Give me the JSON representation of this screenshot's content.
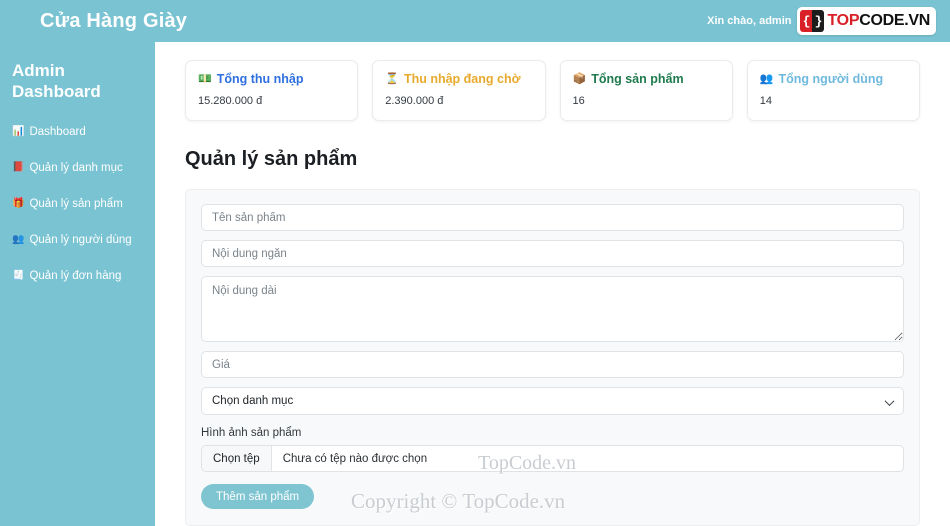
{
  "header": {
    "brand": "Cửa Hàng Giày",
    "greeting": "Xin chào, admin",
    "logo": {
      "mark_left": "{",
      "mark_right": "}",
      "word_top": "TOP",
      "word_code": "CODE.VN"
    }
  },
  "sidebar": {
    "title": "Admin Dashboard",
    "items": [
      {
        "icon": "bar-chart-icon",
        "glyph": "📊",
        "label": "Dashboard"
      },
      {
        "icon": "book-icon",
        "glyph": "📕",
        "label": "Quản lý danh mục"
      },
      {
        "icon": "gift-icon",
        "glyph": "🎁",
        "label": "Quản lý sản phẩm"
      },
      {
        "icon": "users-icon",
        "glyph": "👥",
        "label": "Quản lý người dùng"
      },
      {
        "icon": "receipt-icon",
        "glyph": "🧾",
        "label": "Quản lý đơn hàng"
      }
    ]
  },
  "stats": [
    {
      "icon": "money-icon",
      "glyph": "💵",
      "title": "Tổng thu nhập",
      "value": "15.280.000 đ",
      "color": "#2f6fe0"
    },
    {
      "icon": "hourglass-icon",
      "glyph": "⏳",
      "title": "Thu nhập đang chờ",
      "value": "2.390.000 đ",
      "color": "#e8aa2b"
    },
    {
      "icon": "package-icon",
      "glyph": "📦",
      "title": "Tổng sản phẩm",
      "value": "16",
      "color": "#1f7a4d"
    },
    {
      "icon": "users-group-icon",
      "glyph": "👥",
      "title": "Tổng người dùng",
      "value": "14",
      "color": "#6fb9de"
    }
  ],
  "section": {
    "title": "Quản lý sản phẩm"
  },
  "form": {
    "name_placeholder": "Tên sản phẩm",
    "name_value": "",
    "short_placeholder": "Nội dung ngắn",
    "short_value": "",
    "long_placeholder": "Nội dung dài",
    "long_value": "",
    "price_placeholder": "Giá",
    "price_value": "",
    "category_selected": "Chọn danh mục",
    "image_label": "Hình ảnh sản phẩm",
    "file_button": "Chọn tệp",
    "file_status": "Chưa có tệp nào được chọn",
    "submit_label": "Thêm sản phẩm"
  },
  "watermarks": {
    "brand": "TopCode.vn",
    "copyright": "Copyright © TopCode.vn"
  },
  "theme": {
    "teal": "#79c3d2",
    "panel": "#f8f9fa"
  }
}
